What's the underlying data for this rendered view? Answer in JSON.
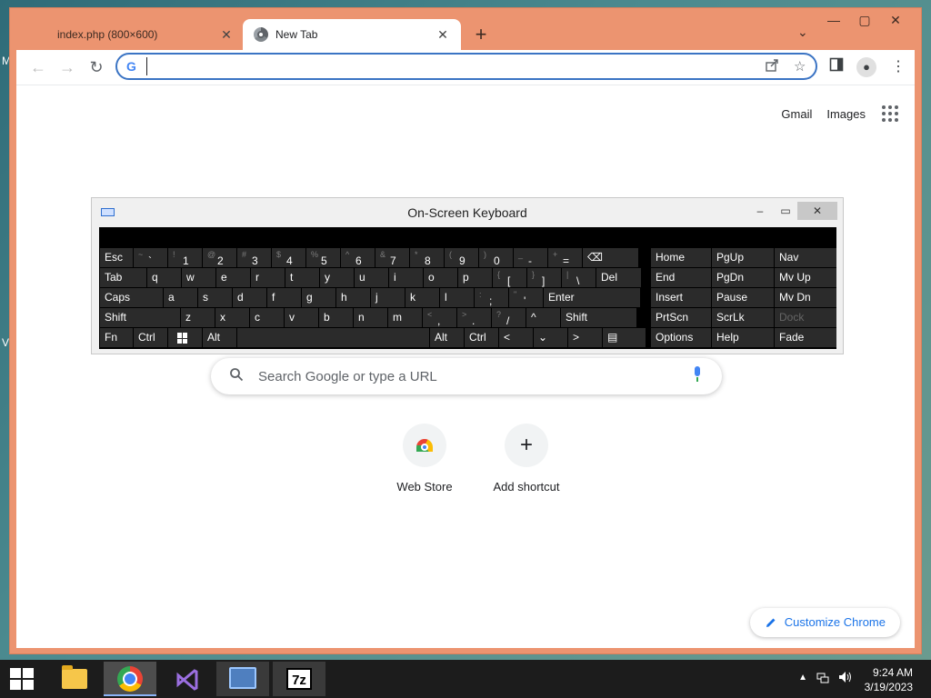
{
  "desktop": {
    "edge_letters": [
      "M",
      "V"
    ]
  },
  "browser": {
    "tabs": [
      {
        "title": "index.php (800×600)",
        "close": "✕"
      },
      {
        "title": "New Tab",
        "close": "✕"
      }
    ],
    "new_tab": "+",
    "tab_search": "⌄",
    "window_controls": {
      "minimize": "—",
      "maximize": "▢",
      "close": "✕"
    },
    "toolbar": {
      "back": "←",
      "forward": "→",
      "reload": "↻",
      "omnibox_value": "",
      "g": "G"
    },
    "ntp": {
      "links": {
        "gmail": "Gmail",
        "images": "Images"
      },
      "search_placeholder": "Search Google or type a URL",
      "shortcuts": [
        {
          "label": "Web Store"
        },
        {
          "label": "Add shortcut",
          "glyph": "+"
        }
      ],
      "customize": "Customize Chrome"
    }
  },
  "osk": {
    "title": "On-Screen Keyboard",
    "controls": {
      "minimize": "–",
      "maximize": "▭",
      "close": "✕"
    },
    "rows": [
      [
        {
          "label": "Esc"
        },
        {
          "shift": "~",
          "main": "`"
        },
        {
          "shift": "!",
          "main": "1"
        },
        {
          "shift": "@",
          "main": "2"
        },
        {
          "shift": "#",
          "main": "3"
        },
        {
          "shift": "$",
          "main": "4"
        },
        {
          "shift": "%",
          "main": "5"
        },
        {
          "shift": "^",
          "main": "6"
        },
        {
          "shift": "&",
          "main": "7"
        },
        {
          "shift": "*",
          "main": "8"
        },
        {
          "shift": "(",
          "main": "9"
        },
        {
          "shift": ")",
          "main": "0"
        },
        {
          "shift": "_",
          "main": "-"
        },
        {
          "shift": "+",
          "main": "="
        },
        {
          "label": "⌫"
        }
      ],
      [
        {
          "label": "Tab"
        },
        {
          "label": "q"
        },
        {
          "label": "w"
        },
        {
          "label": "e"
        },
        {
          "label": "r"
        },
        {
          "label": "t"
        },
        {
          "label": "y"
        },
        {
          "label": "u"
        },
        {
          "label": "i"
        },
        {
          "label": "o"
        },
        {
          "label": "p"
        },
        {
          "shift": "{",
          "main": "["
        },
        {
          "shift": "}",
          "main": "]"
        },
        {
          "shift": "|",
          "main": "\\"
        },
        {
          "label": "Del"
        }
      ],
      [
        {
          "label": "Caps"
        },
        {
          "label": "a"
        },
        {
          "label": "s"
        },
        {
          "label": "d"
        },
        {
          "label": "f"
        },
        {
          "label": "g"
        },
        {
          "label": "h"
        },
        {
          "label": "j"
        },
        {
          "label": "k"
        },
        {
          "label": "l"
        },
        {
          "shift": ":",
          "main": ";"
        },
        {
          "shift": "\"",
          "main": "'"
        },
        {
          "label": "Enter"
        }
      ],
      [
        {
          "label": "Shift"
        },
        {
          "label": "z"
        },
        {
          "label": "x"
        },
        {
          "label": "c"
        },
        {
          "label": "v"
        },
        {
          "label": "b"
        },
        {
          "label": "n"
        },
        {
          "label": "m"
        },
        {
          "shift": "<",
          "main": ","
        },
        {
          "shift": ">",
          "main": "."
        },
        {
          "shift": "?",
          "main": "/"
        },
        {
          "label": "^"
        },
        {
          "label": "Shift"
        }
      ],
      [
        {
          "label": "Fn"
        },
        {
          "label": "Ctrl"
        },
        {
          "label": ""
        },
        {
          "label": "Alt"
        },
        {
          "label": ""
        },
        {
          "label": "Alt"
        },
        {
          "label": "Ctrl"
        },
        {
          "label": "<"
        },
        {
          "label": "⌄"
        },
        {
          "label": ">"
        },
        {
          "label": "▤"
        }
      ]
    ],
    "nav": [
      [
        "Home",
        "PgUp",
        "Nav"
      ],
      [
        "End",
        "PgDn",
        "Mv Up"
      ],
      [
        "Insert",
        "Pause",
        "Mv Dn"
      ],
      [
        "PrtScn",
        "ScrLk",
        "Dock"
      ],
      [
        "Options",
        "Help",
        "Fade"
      ]
    ]
  },
  "taskbar": {
    "apps": [
      "File Explorer",
      "Google Chrome",
      "Visual Studio",
      "On-Screen Keyboard",
      "7-Zip"
    ],
    "sevenzip_label": "7z",
    "tray_up": "▲",
    "time": "9:24 AM",
    "date": "3/19/2023"
  }
}
